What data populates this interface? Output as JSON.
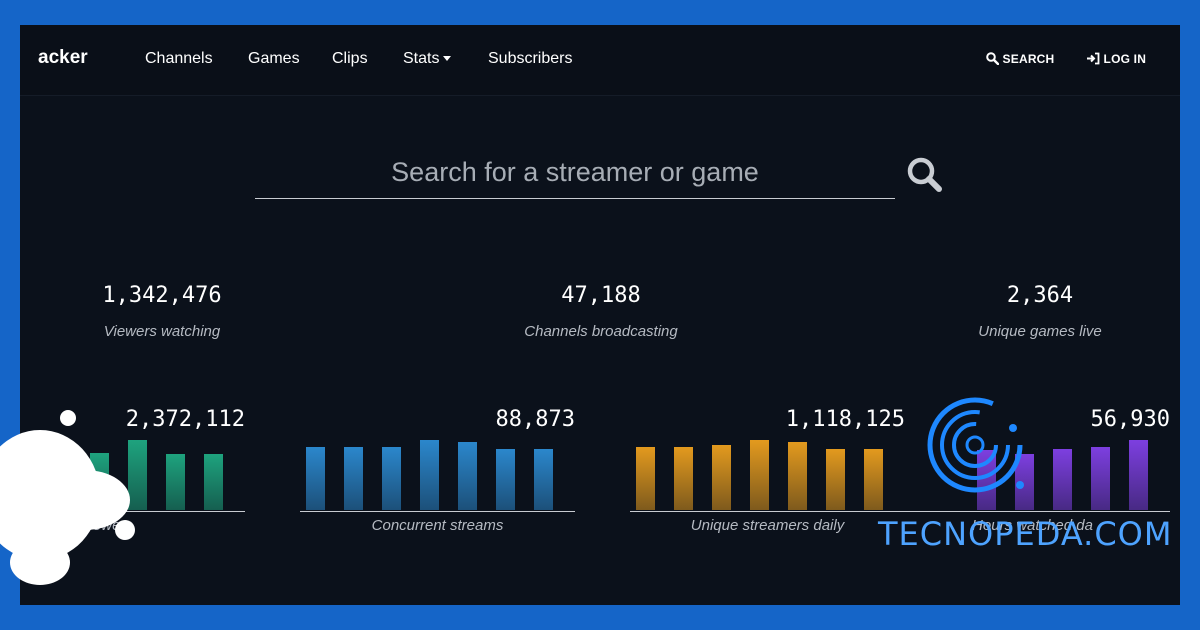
{
  "navbar": {
    "brand": "acker",
    "items": [
      {
        "label": "Channels"
      },
      {
        "label": "Games"
      },
      {
        "label": "Clips"
      },
      {
        "label": "Stats"
      },
      {
        "label": "Subscribers"
      }
    ],
    "search_label": "SEARCH",
    "login_label": "LOG IN"
  },
  "search": {
    "placeholder": "Search for a streamer or game"
  },
  "stats": [
    {
      "value": "1,342,476",
      "label": "Viewers watching"
    },
    {
      "value": "47,188",
      "label": "Channels broadcasting"
    },
    {
      "value": "2,364",
      "label": "Unique games live"
    }
  ],
  "panels": [
    {
      "value": "2,372,112",
      "label": "viewers",
      "color": "#1ea37e",
      "bars": [
        0.82,
        0.82,
        0.82,
        1.0,
        0.8,
        0.8
      ]
    },
    {
      "value": "88,873",
      "label": "Concurrent streams",
      "color": "#2b87cc",
      "bars": [
        0.9,
        0.9,
        0.9,
        1.0,
        0.97,
        0.87,
        0.87
      ]
    },
    {
      "value": "1,118,125",
      "label": "Unique streamers daily",
      "color": "#e39a1e",
      "bars": [
        0.9,
        0.9,
        0.93,
        1.0,
        0.97,
        0.87,
        0.87
      ]
    },
    {
      "value": "56,930",
      "label": "Hours watched da",
      "color": "#7d3fe0",
      "bars": [
        0.85,
        0.8,
        0.87,
        0.9,
        1.0
      ]
    }
  ],
  "watermark": "TECNOPEDA.COM",
  "colors": {
    "background": "#0b111b",
    "frame": "#1565c8",
    "watermark": "#4ea3ff"
  }
}
